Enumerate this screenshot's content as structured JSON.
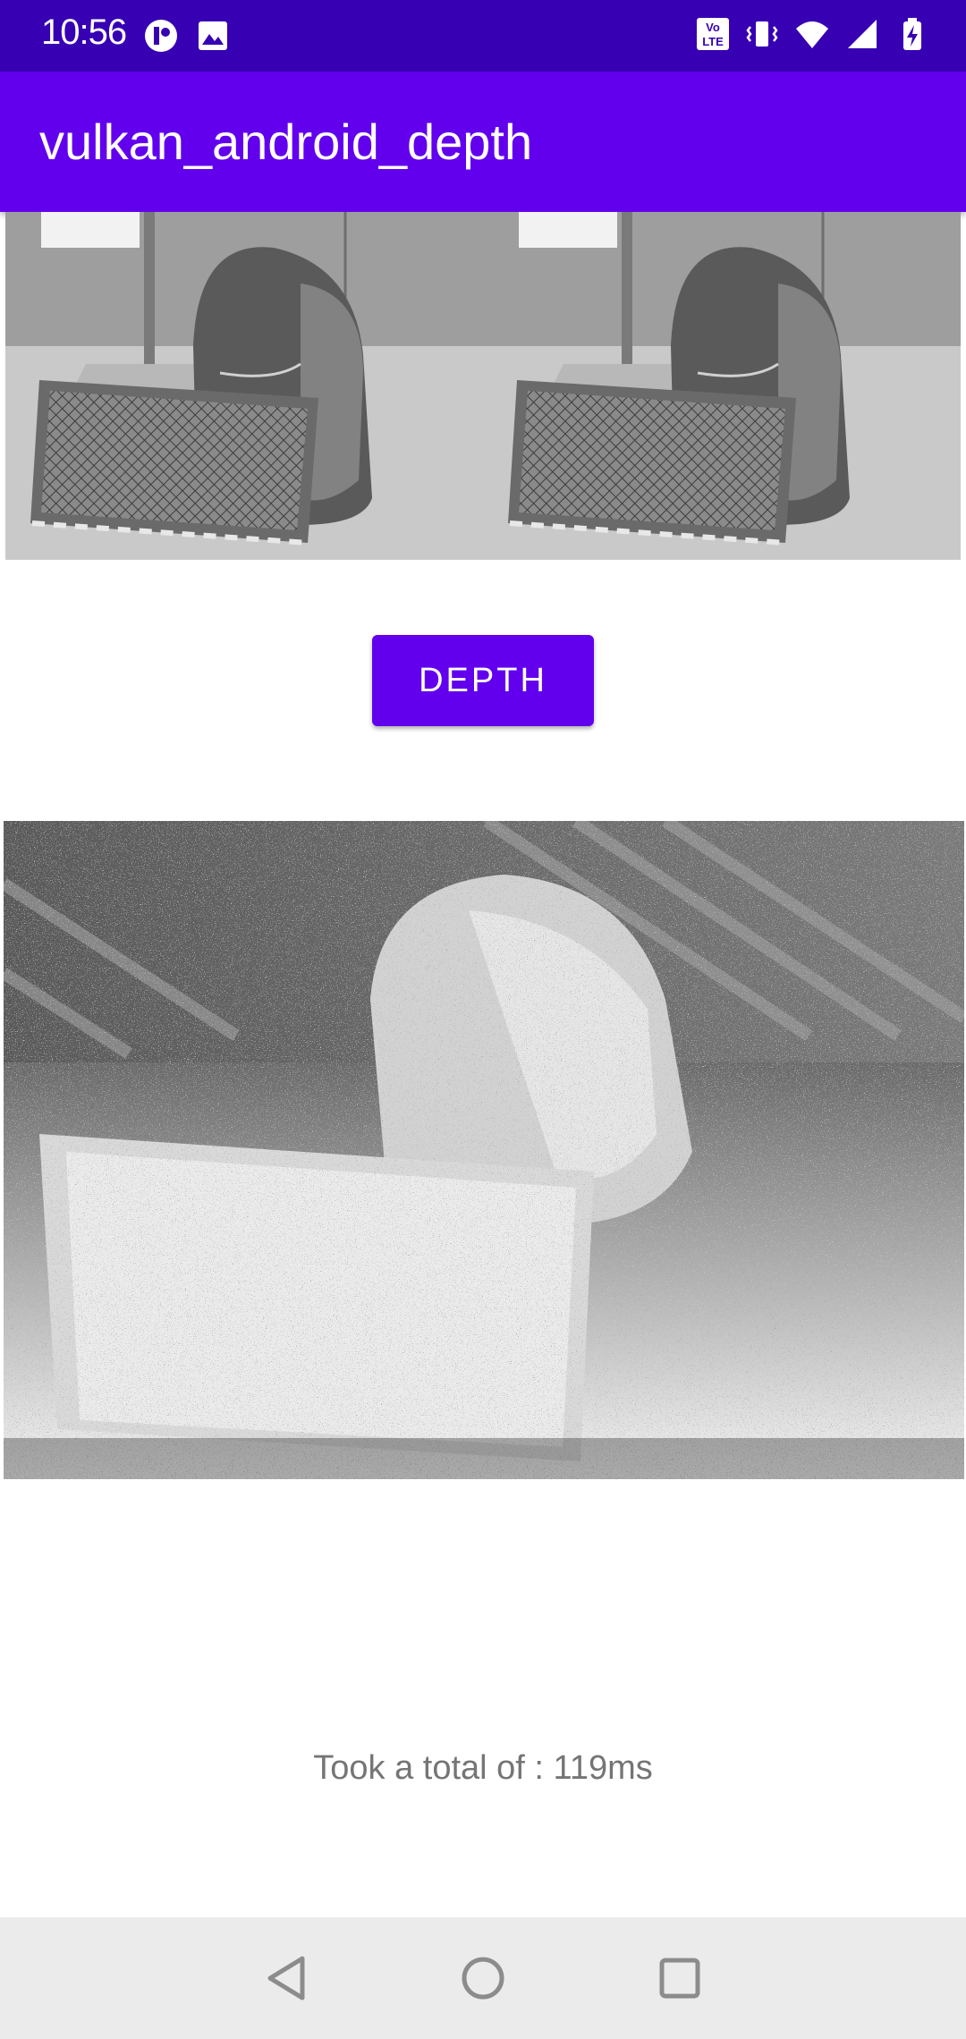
{
  "status_bar": {
    "time": "10:56",
    "left_icons": [
      "notification-app-icon",
      "image-icon"
    ],
    "right_icons": [
      "volte-icon",
      "vibrate-icon",
      "wifi-icon",
      "signal-icon",
      "battery-charging-icon"
    ],
    "volte_text": "Vo LTE"
  },
  "app_bar": {
    "title": "vulkan_android_depth"
  },
  "main": {
    "depth_button_label": "DEPTH",
    "result_text": "Took a total of : 119ms"
  },
  "nav_bar": {
    "buttons": [
      "back-icon",
      "home-icon",
      "recents-icon"
    ]
  },
  "colors": {
    "status_bar": "#3700b3",
    "app_bar": "#6200ee",
    "button": "#6200ee",
    "nav_bar": "#ebebeb"
  }
}
